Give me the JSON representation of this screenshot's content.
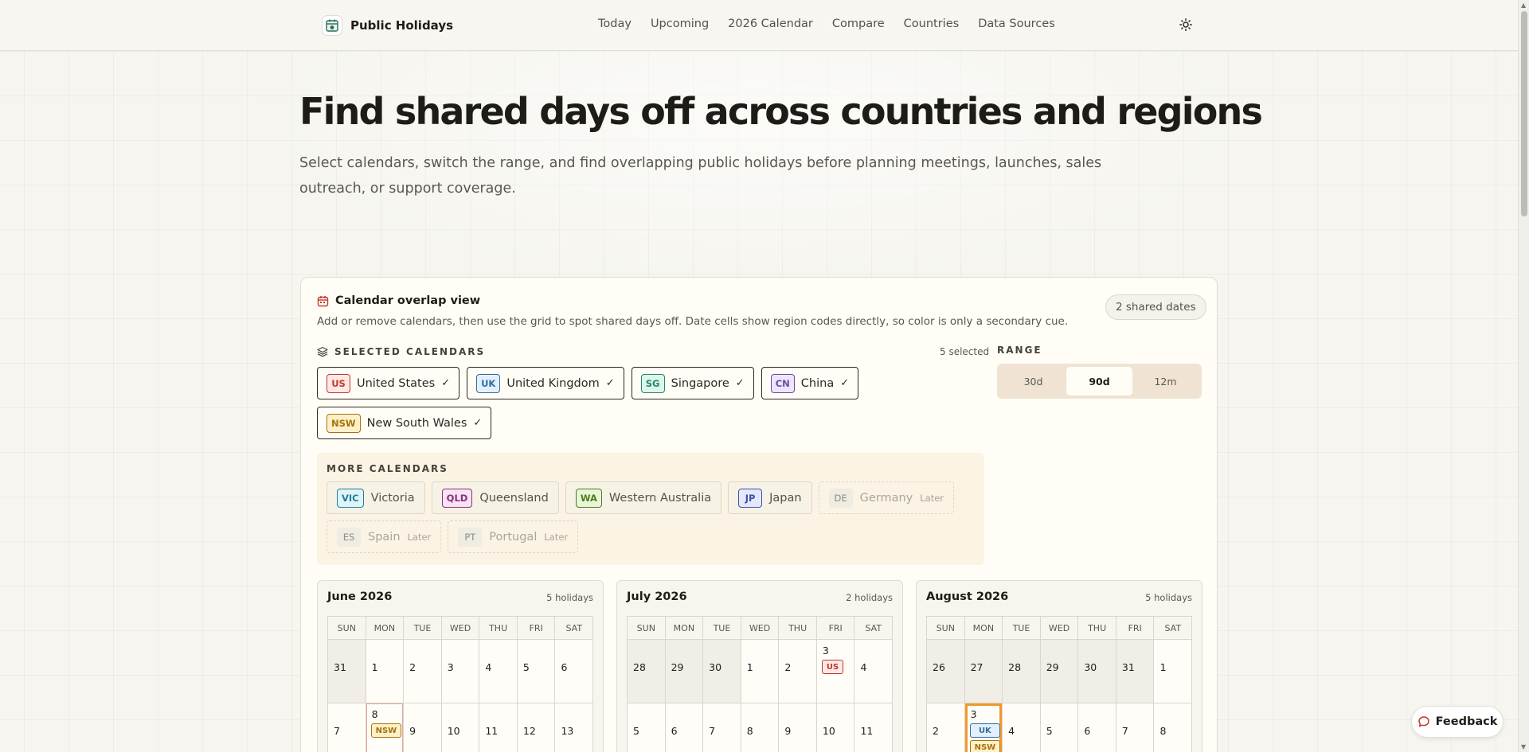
{
  "brand": {
    "name": "Public Holidays",
    "logo_icon": "calendar-globe-icon"
  },
  "nav": [
    "Today",
    "Upcoming",
    "2026 Calendar",
    "Compare",
    "Countries",
    "Data Sources"
  ],
  "hero": {
    "title": "Find shared days off across countries and regions",
    "subtitle": "Select calendars, switch the range, and find overlapping public holidays before planning meetings, launches, sales outreach, or support coverage."
  },
  "card": {
    "title": "Calendar overlap view",
    "description": "Add or remove calendars, then use the grid to spot shared days off. Date cells show region codes directly, so color is only a secondary cue.",
    "shared_badge": "2 shared dates",
    "selected_label": "SELECTED CALENDARS",
    "selected_count": "5 selected",
    "range_label": "RANGE",
    "range_options": [
      "30d",
      "90d",
      "12m"
    ],
    "range_selected": "90d",
    "selected": [
      {
        "code": "US",
        "name": "United States",
        "color": "#c0392b",
        "bg": "#fde8e6"
      },
      {
        "code": "UK",
        "name": "United Kingdom",
        "color": "#2e6da4",
        "bg": "#e3f0fb"
      },
      {
        "code": "SG",
        "name": "Singapore",
        "color": "#1e8a66",
        "bg": "#dff5ec"
      },
      {
        "code": "CN",
        "name": "China",
        "color": "#6a4aa8",
        "bg": "#ece6f8"
      },
      {
        "code": "NSW",
        "name": "New South Wales",
        "color": "#a8720d",
        "bg": "#fdf0c8"
      }
    ],
    "more_label": "MORE CALENDARS",
    "more": [
      {
        "code": "VIC",
        "name": "Victoria",
        "color": "#1f7f9a",
        "bg": "#dff3f8",
        "later": ""
      },
      {
        "code": "QLD",
        "name": "Queensland",
        "color": "#8a2f7e",
        "bg": "#f6e3f3",
        "later": ""
      },
      {
        "code": "WA",
        "name": "Western Australia",
        "color": "#4f7d1c",
        "bg": "#e9f5d9",
        "later": ""
      },
      {
        "code": "JP",
        "name": "Japan",
        "color": "#3b4fa8",
        "bg": "#e4e8fa",
        "later": ""
      },
      {
        "code": "DE",
        "name": "Germany",
        "later": "Later"
      },
      {
        "code": "ES",
        "name": "Spain",
        "later": "Later"
      },
      {
        "code": "PT",
        "name": "Portugal",
        "later": "Later"
      }
    ]
  },
  "days_of_week": [
    "SUN",
    "MON",
    "TUE",
    "WED",
    "THU",
    "FRI",
    "SAT"
  ],
  "months": [
    {
      "title": "June 2026",
      "count": "5 holidays",
      "weeks": [
        [
          {
            "d": "31",
            "out": true
          },
          {
            "d": "1"
          },
          {
            "d": "2"
          },
          {
            "d": "3"
          },
          {
            "d": "4"
          },
          {
            "d": "5"
          },
          {
            "d": "6"
          }
        ],
        [
          {
            "d": "7"
          },
          {
            "d": "8",
            "tags": [
              "NSW"
            ],
            "hol": true
          },
          {
            "d": "9"
          },
          {
            "d": "10"
          },
          {
            "d": "11"
          },
          {
            "d": "12"
          },
          {
            "d": "13"
          }
        ]
      ]
    },
    {
      "title": "July 2026",
      "count": "2 holidays",
      "weeks": [
        [
          {
            "d": "28",
            "out": true
          },
          {
            "d": "29",
            "out": true
          },
          {
            "d": "30",
            "out": true
          },
          {
            "d": "1"
          },
          {
            "d": "2"
          },
          {
            "d": "3",
            "tags": [
              "US"
            ]
          },
          {
            "d": "4"
          }
        ],
        [
          {
            "d": "5"
          },
          {
            "d": "6"
          },
          {
            "d": "7"
          },
          {
            "d": "8"
          },
          {
            "d": "9"
          },
          {
            "d": "10"
          },
          {
            "d": "11"
          }
        ]
      ]
    },
    {
      "title": "August 2026",
      "count": "5 holidays",
      "weeks": [
        [
          {
            "d": "26",
            "out": true
          },
          {
            "d": "27",
            "out": true
          },
          {
            "d": "28",
            "out": true
          },
          {
            "d": "29",
            "out": true
          },
          {
            "d": "30",
            "out": true
          },
          {
            "d": "31",
            "out": true
          },
          {
            "d": "1"
          }
        ],
        [
          {
            "d": "2"
          },
          {
            "d": "3",
            "tags": [
              "UK",
              "NSW"
            ],
            "shared": true
          },
          {
            "d": "4"
          },
          {
            "d": "5"
          },
          {
            "d": "6"
          },
          {
            "d": "7"
          },
          {
            "d": "8"
          }
        ]
      ]
    }
  ],
  "feedback": {
    "label": "Feedback",
    "icon": "chat-bubble-icon"
  }
}
